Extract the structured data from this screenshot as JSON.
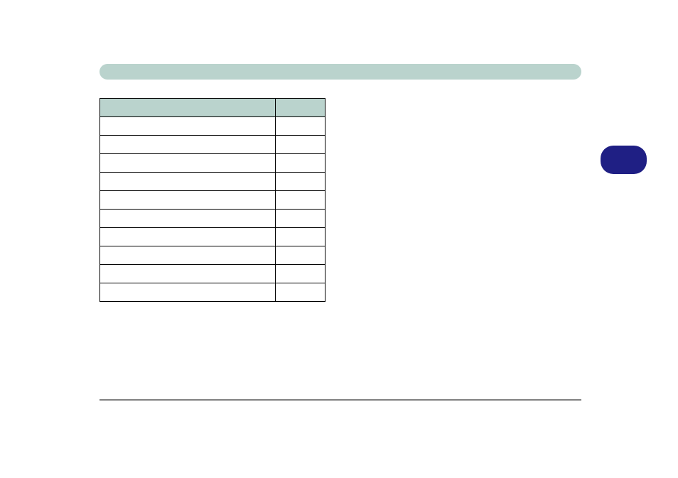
{
  "header": {
    "title": ""
  },
  "table": {
    "headers": {
      "col_a": "",
      "col_b": ""
    },
    "rows": [
      {
        "a": "",
        "b": ""
      },
      {
        "a": "",
        "b": ""
      },
      {
        "a": "",
        "b": ""
      },
      {
        "a": "",
        "b": ""
      },
      {
        "a": "",
        "b": ""
      },
      {
        "a": "",
        "b": ""
      },
      {
        "a": "",
        "b": ""
      },
      {
        "a": "",
        "b": ""
      },
      {
        "a": "",
        "b": ""
      },
      {
        "a": "",
        "b": ""
      }
    ]
  },
  "page_tab": {
    "label": ""
  }
}
